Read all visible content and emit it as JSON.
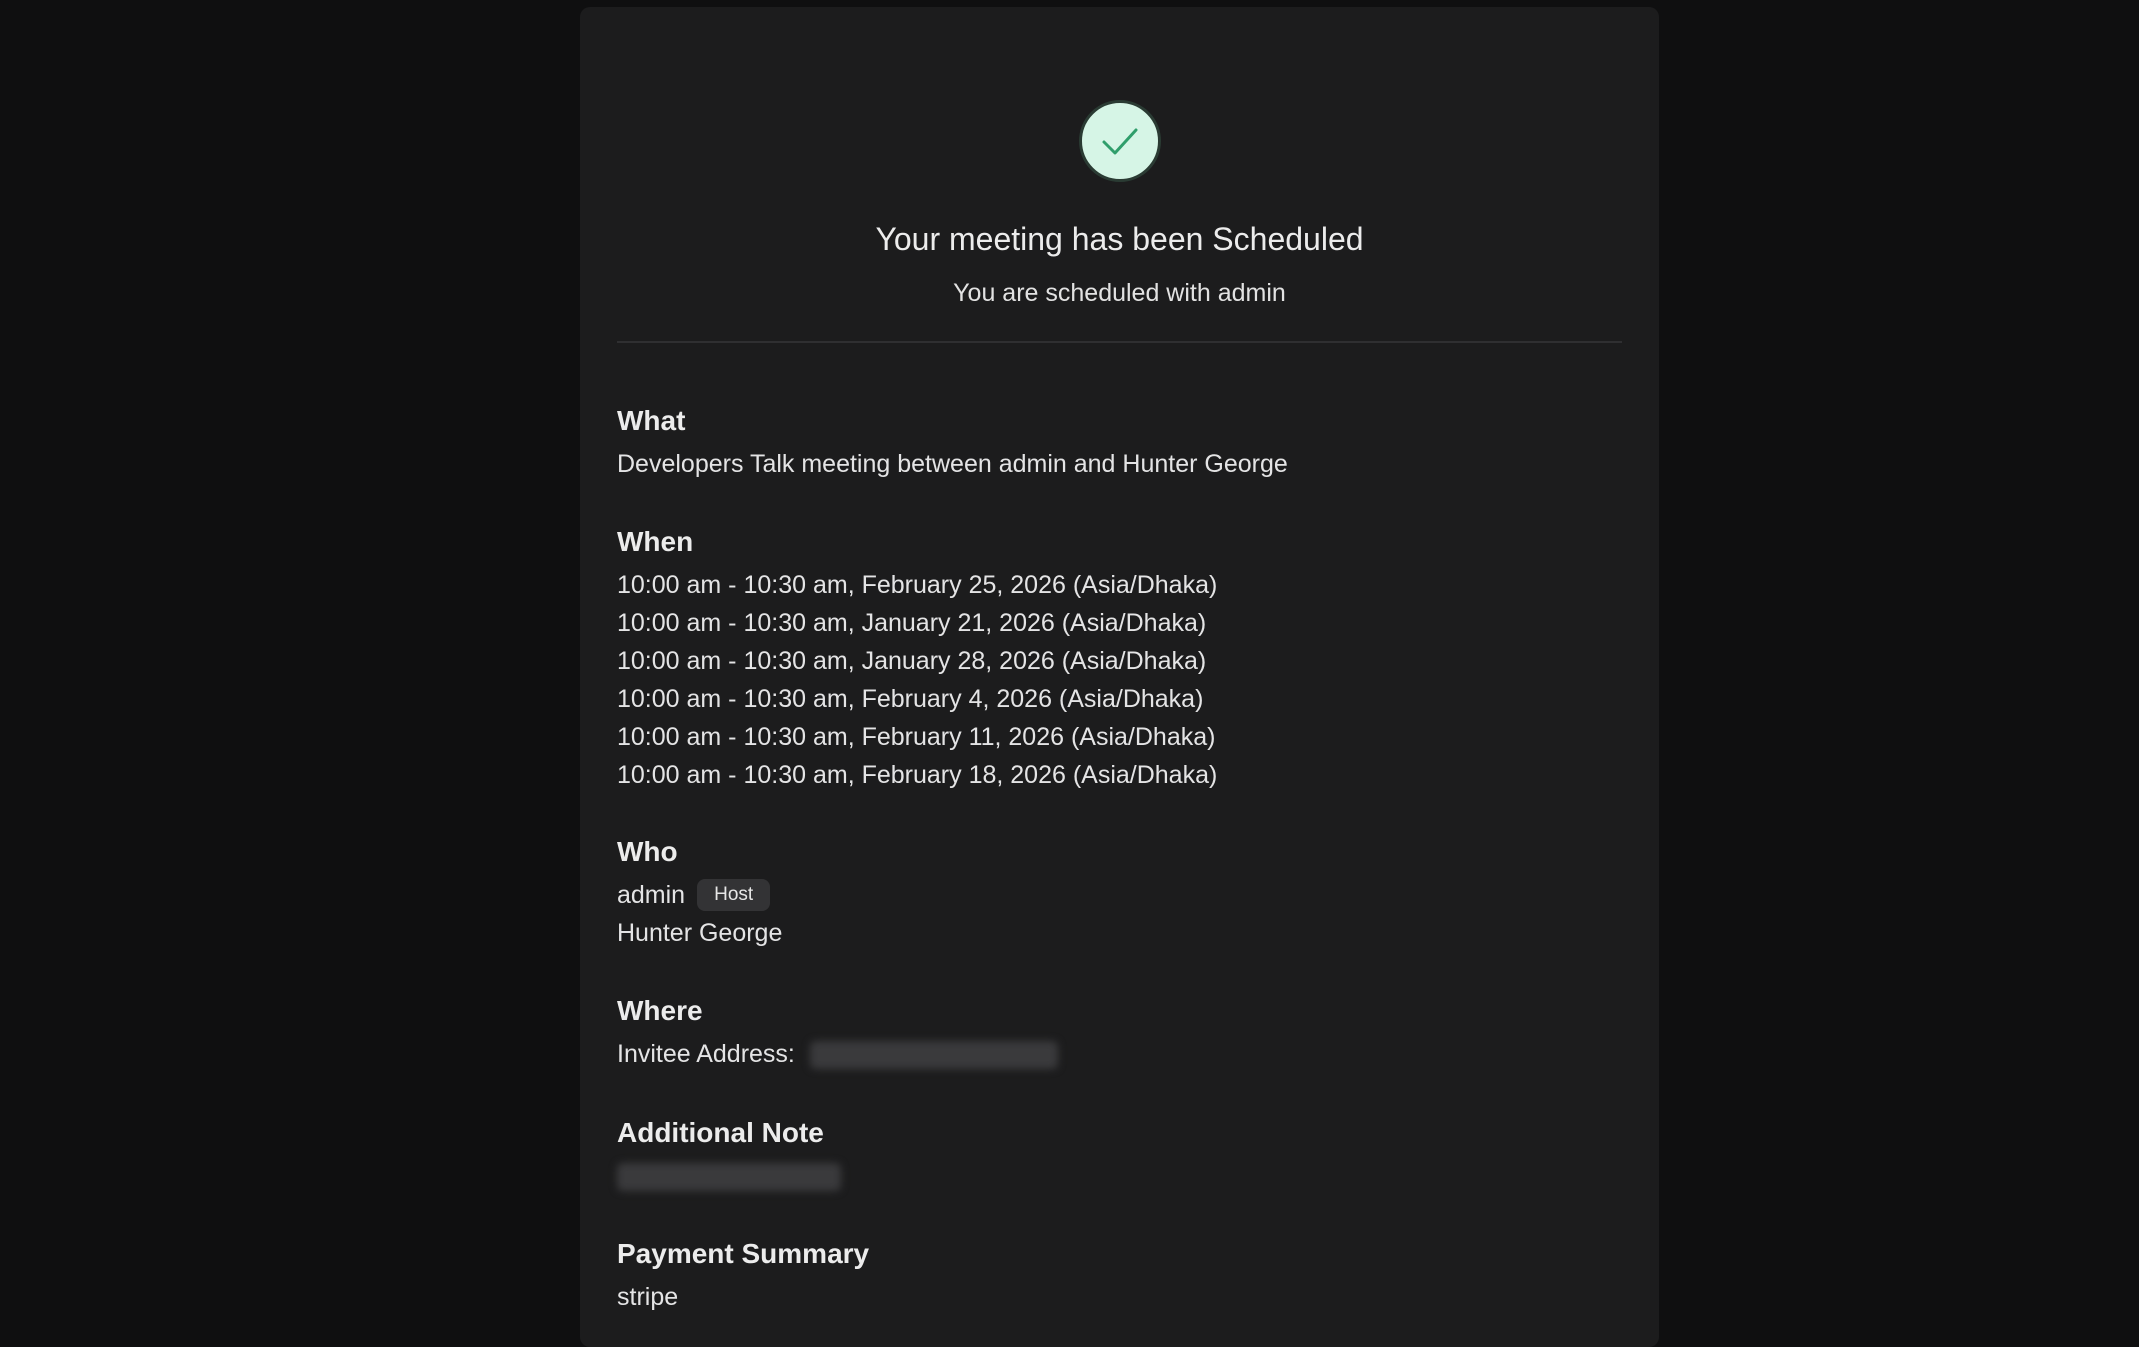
{
  "confirmation": {
    "title": "Your meeting has been Scheduled",
    "subtitle": "You are scheduled with admin"
  },
  "what": {
    "heading": "What",
    "value": "Developers Talk meeting between admin and Hunter George"
  },
  "when": {
    "heading": "When",
    "slots": [
      "10:00 am - 10:30 am, February 25, 2026 (Asia/Dhaka)",
      "10:00 am - 10:30 am, January 21, 2026 (Asia/Dhaka)",
      "10:00 am - 10:30 am, January 28, 2026 (Asia/Dhaka)",
      "10:00 am - 10:30 am, February 4, 2026 (Asia/Dhaka)",
      "10:00 am - 10:30 am, February 11, 2026 (Asia/Dhaka)",
      "10:00 am - 10:30 am, February 18, 2026 (Asia/Dhaka)"
    ]
  },
  "who": {
    "heading": "Who",
    "host_name": "admin",
    "host_badge": "Host",
    "invitee_name": "Hunter George"
  },
  "where": {
    "heading": "Where",
    "label": "Invitee Address:"
  },
  "note": {
    "heading": "Additional Note"
  },
  "payment": {
    "heading": "Payment Summary",
    "method": "stripe"
  },
  "colors": {
    "page_bg": "#0f0f10",
    "card_bg": "#1c1c1d",
    "success_circle": "#d6f5e6",
    "success_check": "#2f9e6b"
  },
  "icons": {
    "success": "check-icon"
  }
}
